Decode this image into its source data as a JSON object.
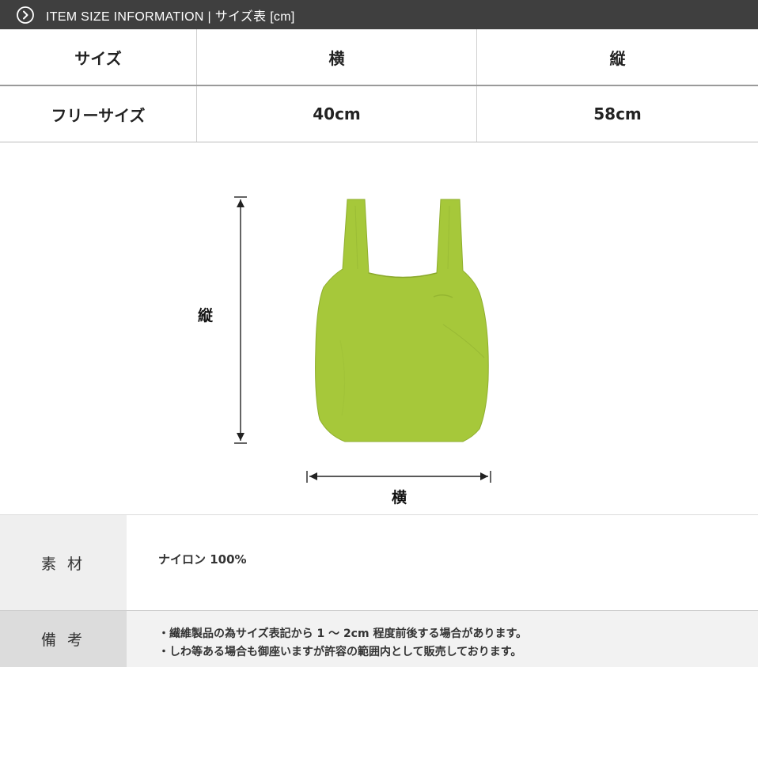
{
  "header": {
    "icon": "circle-chevron-right-icon",
    "title": "ITEM SIZE INFORMATION | サイズ表 [cm]",
    "background": "#3f3f3f"
  },
  "size_table": {
    "columns": [
      "サイズ",
      "横",
      "縦"
    ],
    "rows": [
      [
        "フリーサイズ",
        "40cm",
        "58cm"
      ]
    ]
  },
  "diagram": {
    "vertical_label": "縦",
    "horizontal_label": "横",
    "bag_color": "#a6c83a"
  },
  "material": {
    "label": "素 材",
    "value": "ナイロン 100%"
  },
  "notes": {
    "label": "備 考",
    "lines": [
      "・繊維製品の為サイズ表記から 1 ～ 2cm 程度前後する場合があります。",
      "・しわ等ある場合も御座いますが許容の範囲内として販売しております。"
    ]
  }
}
